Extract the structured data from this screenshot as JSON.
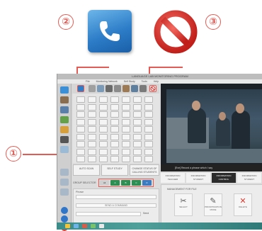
{
  "callouts": {
    "one": "①",
    "two": "②",
    "three": "③"
  },
  "icons": {
    "phone": "phone-icon",
    "prohibit": "prohibited-icon"
  },
  "colors": {
    "callout": "#e25c55",
    "phone_blue": "#2d7dc8",
    "stop_red": "#d8332c"
  },
  "window": {
    "title": "LANGUAGE LAB MONITORING PROGRAM",
    "menu": [
      "File",
      "Monitoring Network",
      "Self Study",
      "Tools",
      "Help"
    ],
    "buttons": [
      "AUTO SCAN",
      "SELF STUDY",
      "CHANGE STATUS OF CALLING STUDENTS"
    ],
    "group_selector_label": "GROUP SELECTOR",
    "group_buttons": [
      "All",
      "A",
      "B",
      "C",
      "D"
    ],
    "lower_panel_label": "Phrase",
    "lower_field": "SEND A COMMAND",
    "send_label": "Send",
    "video_caption": "[Eve] Record a phrase which I say",
    "tabs": [
      "INFORMATION TEACHER",
      "INFORMATION STUDENT",
      "INFORMATION CONTROL",
      "INFORMATION STUDENT"
    ],
    "management_label": "MANAGEMENT FOR FILE",
    "mgmt_buttons": [
      "SELECT",
      "PRIORITIZATION MODE",
      "DELETE"
    ]
  }
}
